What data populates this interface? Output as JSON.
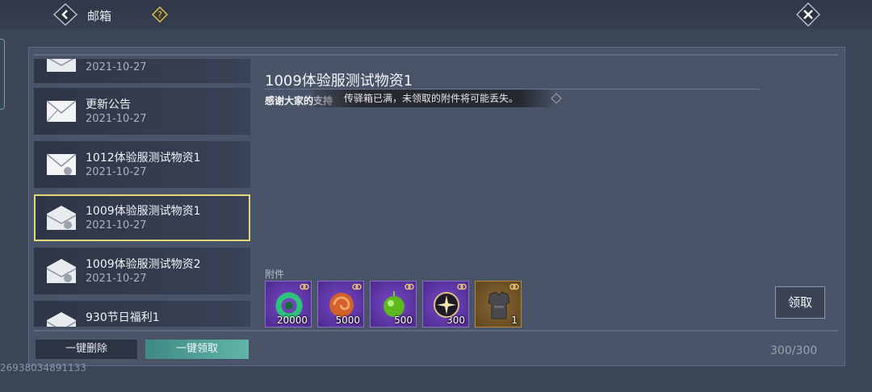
{
  "header": {
    "title": "邮箱"
  },
  "mails": [
    {
      "title": "",
      "date": "2021-10-27"
    },
    {
      "title": "更新公告",
      "date": "2021-10-27"
    },
    {
      "title": "1012体验服测试物资1",
      "date": "2021-10-27"
    },
    {
      "title": "1009体验服测试物资1",
      "date": "2021-10-27"
    },
    {
      "title": "1009体验服测试物资2",
      "date": "2021-10-27"
    },
    {
      "title": "930节日福利1",
      "date": ""
    }
  ],
  "detail": {
    "title": "1009体验服测试物资1",
    "body": "感谢大家的支持",
    "toast": "传驿箱已满，未领取的附件将可能丢失。",
    "attachments_label": "附件",
    "claim_label": "领取"
  },
  "attachments": [
    {
      "icon": "jade-ring-icon",
      "count": "20000"
    },
    {
      "icon": "red-swirl-icon",
      "count": "5000"
    },
    {
      "icon": "green-orb-icon",
      "count": "500"
    },
    {
      "icon": "star-orb-icon",
      "count": "300"
    },
    {
      "icon": "armor-icon",
      "count": "1"
    }
  ],
  "footer": {
    "delete_all": "一键删除",
    "claim_all": "一键领取",
    "capacity": "300/300"
  },
  "uid": "26938034891133",
  "colors": {
    "selected_border": "#e3d77a",
    "claim_all_bg": "#4f9e96",
    "purple_slot": "#6a3bbd",
    "gold_slot": "#8a6a32"
  }
}
